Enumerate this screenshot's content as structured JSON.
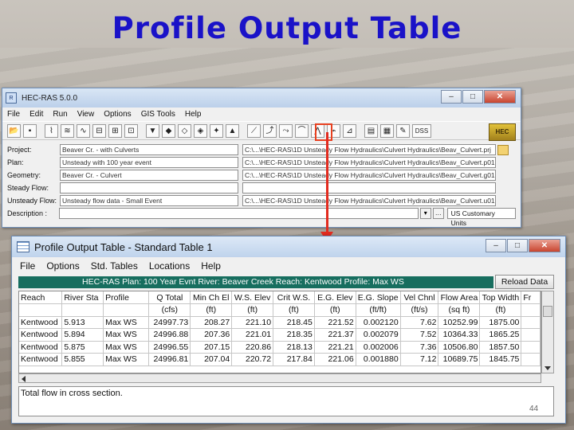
{
  "slide": {
    "title": "Profile Output Table",
    "page_number": "44"
  },
  "ras": {
    "title": "HEC-RAS 5.0.0",
    "menu": [
      "File",
      "Edit",
      "Run",
      "View",
      "Options",
      "GIS Tools",
      "Help"
    ],
    "dss_label": "DSS",
    "fields": [
      {
        "label": "Project:",
        "left": "Beaver Cr. - with Culverts",
        "right": "C:\\...\\HEC-RAS\\1D Unsteady Flow Hydraulics\\Culvert Hydraulics\\Beav_Culvert.prj"
      },
      {
        "label": "Plan:",
        "left": "Unsteady with 100 year event",
        "right": "C:\\...\\HEC-RAS\\1D Unsteady Flow Hydraulics\\Culvert Hydraulics\\Beav_Culvert.p01"
      },
      {
        "label": "Geometry:",
        "left": "Beaver Cr. - Culvert",
        "right": "C:\\...\\HEC-RAS\\1D Unsteady Flow Hydraulics\\Culvert Hydraulics\\Beav_Culvert.g01"
      },
      {
        "label": "Steady Flow:",
        "left": "",
        "right": ""
      },
      {
        "label": "Unsteady Flow:",
        "left": "Unsteady flow data - Small Event",
        "right": "C:\\...\\HEC-RAS\\1D Unsteady Flow Hydraulics\\Culvert Hydraulics\\Beav_Culvert.u01"
      }
    ],
    "description_label": "Description :",
    "description_value": "",
    "units_label": "US Customary Units"
  },
  "pot": {
    "title": "Profile Output Table - Standard Table 1",
    "menu": [
      "File",
      "Options",
      "Std. Tables",
      "Locations",
      "Help"
    ],
    "info": "HEC-RAS  Plan: 100 Year Evnt   River: Beaver Creek   Reach: Kentwood    Profile: Max WS",
    "reload_label": "Reload Data",
    "columns": [
      "Reach",
      "River Sta",
      "Profile",
      "Q Total",
      "Min Ch El",
      "W.S. Elev",
      "Crit W.S.",
      "E.G. Elev",
      "E.G. Slope",
      "Vel Chnl",
      "Flow Area",
      "Top Width",
      "Fr"
    ],
    "units": [
      "",
      "",
      "",
      "(cfs)",
      "(ft)",
      "(ft)",
      "(ft)",
      "(ft)",
      "(ft/ft)",
      "(ft/s)",
      "(sq ft)",
      "(ft)",
      ""
    ],
    "rows": [
      [
        "Kentwood",
        "5.913",
        "Max WS",
        "24997.73",
        "208.27",
        "221.10",
        "218.45",
        "221.52",
        "0.002120",
        "7.62",
        "10252.99",
        "1875.00",
        ""
      ],
      [
        "Kentwood",
        "5.894",
        "Max WS",
        "24996.88",
        "207.36",
        "221.01",
        "218.35",
        "221.37",
        "0.002079",
        "7.52",
        "10364.33",
        "1865.25",
        ""
      ],
      [
        "Kentwood",
        "5.875",
        "Max WS",
        "24996.55",
        "207.15",
        "220.86",
        "218.13",
        "221.21",
        "0.002006",
        "7.36",
        "10506.80",
        "1857.50",
        ""
      ],
      [
        "Kentwood",
        "5.855",
        "Max WS",
        "24996.81",
        "207.04",
        "220.72",
        "217.84",
        "221.06",
        "0.001880",
        "7.12",
        "10689.75",
        "1845.75",
        ""
      ]
    ],
    "status": "Total flow in cross section."
  }
}
